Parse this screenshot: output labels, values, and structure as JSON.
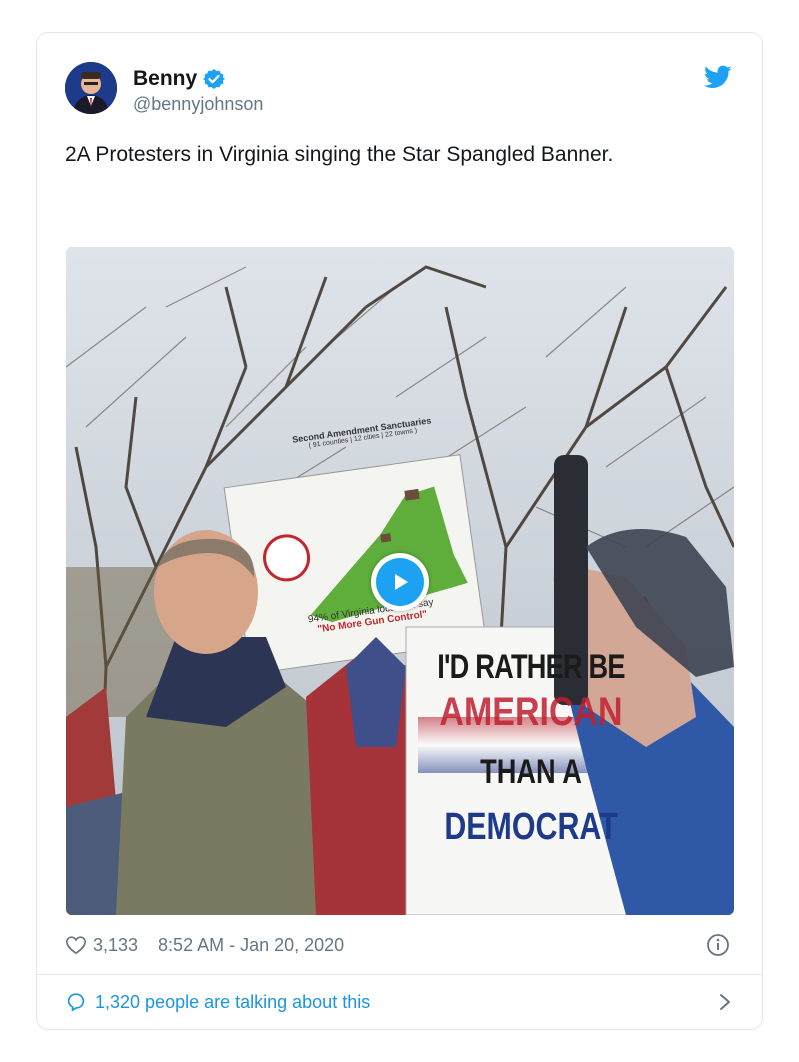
{
  "tweet": {
    "display_name": "Benny",
    "handle": "@bennyjohnson",
    "text": "2A Protesters in Virginia singing the Star Spangled Banner.",
    "likes": "3,133",
    "timestamp": "8:52 AM - Jan 20, 2020",
    "conversation": "1,320 people are talking about this"
  },
  "media_signs": {
    "sign_title": "Second Amendment Sanctuaries",
    "sign_subtitle": "( 91 counties | 12 cities | 22 towns )",
    "sign_caption": "94% of Virginia localities say",
    "sign_quote": "\"No More Gun Control\"",
    "banner_line1": "I'D RATHER BE",
    "banner_line2": "AMERICAN",
    "banner_line3": "THAN A",
    "banner_line4": "DEMOCRAT"
  },
  "colors": {
    "accent": "#1da1f2",
    "link": "#1b95e0",
    "secondary_text": "#657786",
    "border": "#e1e8ed"
  },
  "icons": [
    "verified-badge-icon",
    "twitter-bird-icon",
    "play-icon",
    "heart-icon",
    "info-icon",
    "comment-icon",
    "chevron-right-icon"
  ]
}
